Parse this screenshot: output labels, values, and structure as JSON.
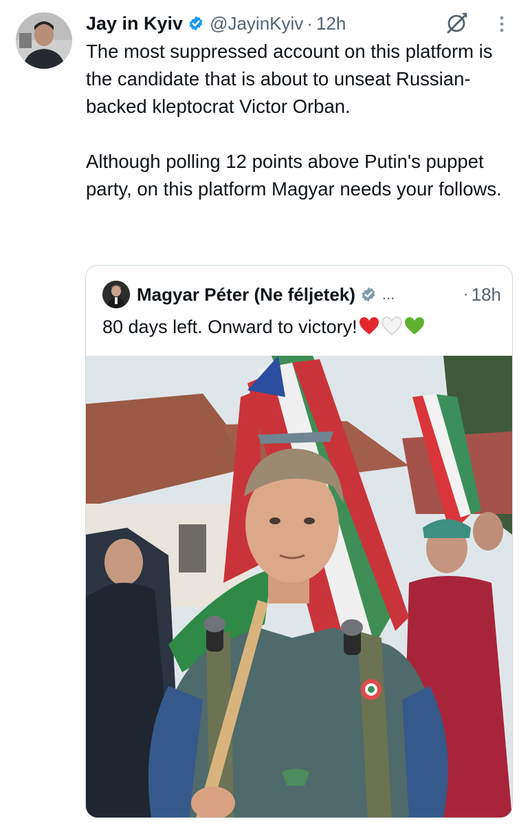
{
  "tweet": {
    "author_name": "Jay in Kyiv",
    "handle": "@JayinKyiv",
    "separator": "·",
    "time": "12h",
    "paragraphs": [
      "The most suppressed account on this platform is the candidate that is about to unseat Russian-backed kleptocrat Victor Orban.",
      "Although polling 12 points above Putin's puppet party, on this platform Magyar needs your follows."
    ],
    "icons": [
      "verified-badge-icon",
      "grok-icon",
      "more-options-icon"
    ]
  },
  "quoted_tweet": {
    "author_name": "Magyar Péter (Ne féljetek)",
    "ellipsis": "...",
    "separator": "·",
    "time": "18h",
    "text": "80 days left. Onward to victory!",
    "emojis": [
      "red-heart",
      "white-heart",
      "green-heart"
    ]
  },
  "colors": {
    "text_primary": "#0f1419",
    "text_secondary": "#536471",
    "verified_blue": "#1d9bf0",
    "border": "#cfd9de"
  }
}
